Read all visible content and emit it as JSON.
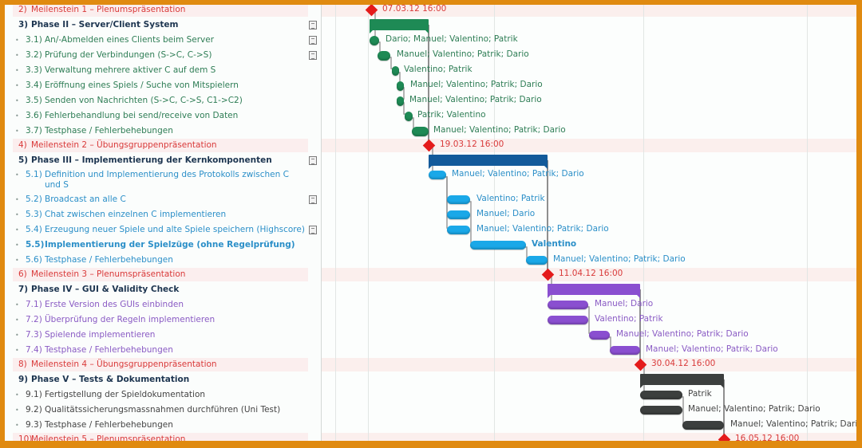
{
  "colors": {
    "phase2": "#1e8a55",
    "phase3": "#135a9a",
    "phase3_task": "#1aa8e8",
    "phase4": "#8a4fd0",
    "phase5": "#3c3f3e",
    "milestone": "#e41b1b",
    "frame": "#e08a10"
  },
  "tasks": [
    {
      "num": "2)",
      "label": "Meilenstein 1 – Plenumspräsentation",
      "kind": "milestone",
      "date": "07.03.12 16:00"
    },
    {
      "num": "3)",
      "label": "Phase II – Server/Client System",
      "kind": "phase",
      "note": true
    },
    {
      "num": "3.1)",
      "label": "An/-Abmelden eines Clients beim Server",
      "kind": "task",
      "note": true,
      "resources": "Dario; Manuel; Valentino; Patrik"
    },
    {
      "num": "3.2)",
      "label": "Prüfung der Verbindungen (S->C, C->S)",
      "kind": "task",
      "note": true,
      "resources": "Manuel; Valentino; Patrik; Dario"
    },
    {
      "num": "3.3)",
      "label": "Verwaltung mehrere aktiver C auf dem S",
      "kind": "task",
      "resources": "Valentino; Patrik"
    },
    {
      "num": "3.4)",
      "label": "Eröffnung eines Spiels / Suche von Mitspielern",
      "kind": "task",
      "resources": "Manuel; Valentino; Patrik; Dario"
    },
    {
      "num": "3.5)",
      "label": "Senden von Nachrichten (S->C, C->S, C1->C2)",
      "kind": "task",
      "resources": "Manuel; Valentino; Patrik; Dario"
    },
    {
      "num": "3.6)",
      "label": "Fehlerbehandlung bei send/receive von Daten",
      "kind": "task",
      "resources": "Patrik; Valentino"
    },
    {
      "num": "3.7)",
      "label": "Testphase / Fehlerbehebungen",
      "kind": "task",
      "resources": "Manuel; Valentino; Patrik; Dario"
    },
    {
      "num": "4)",
      "label": "Meilenstein 2 – Übungsgruppenpräsentation",
      "kind": "milestone",
      "date": "19.03.12 16:00"
    },
    {
      "num": "5)",
      "label": "Phase III – Implementierung der Kernkomponenten",
      "kind": "phase",
      "note": true
    },
    {
      "num": "5.1)",
      "label": "Definition und Implementierung des Protokolls zwischen C und S",
      "kind": "task",
      "resources": "Manuel; Valentino; Patrik; Dario"
    },
    {
      "num": "5.2)",
      "label": "Broadcast an alle C",
      "kind": "task",
      "note": true,
      "resources": "Valentino; Patrik"
    },
    {
      "num": "5.3)",
      "label": "Chat zwischen einzelnen C implementieren",
      "kind": "task",
      "resources": "Manuel; Dario"
    },
    {
      "num": "5.4)",
      "label": "Erzeugung neuer Spiele und alte Spiele speichern (Highscore)",
      "kind": "task",
      "note": true,
      "resources": "Manuel; Valentino; Patrik; Dario"
    },
    {
      "num": "5.5)",
      "label": "Implementierung der Spielzüge (ohne Regelprüfung)",
      "kind": "task",
      "bold": true,
      "resources": "Valentino"
    },
    {
      "num": "5.6)",
      "label": "Testphase / Fehlerbehebungen",
      "kind": "task",
      "resources": "Manuel; Valentino; Patrik; Dario"
    },
    {
      "num": "6)",
      "label": "Meilenstein 3 – Plenumspräsentation",
      "kind": "milestone",
      "date": "11.04.12 16:00"
    },
    {
      "num": "7)",
      "label": "Phase IV – GUI & Validity Check",
      "kind": "phase"
    },
    {
      "num": "7.1)",
      "label": "Erste Version des GUIs einbinden",
      "kind": "task",
      "resources": "Manuel; Dario"
    },
    {
      "num": "7.2)",
      "label": "Überprüfung der Regeln implementieren",
      "kind": "task",
      "resources": "Valentino; Patrik"
    },
    {
      "num": "7.3)",
      "label": "Spielende implementieren",
      "kind": "task",
      "resources": "Manuel; Valentino; Patrik; Dario"
    },
    {
      "num": "7.4)",
      "label": "Testphase / Fehlerbehebungen",
      "kind": "task",
      "resources": "Manuel; Valentino; Patrik; Dario"
    },
    {
      "num": "8)",
      "label": "Meilenstein 4 – Übungsgruppenpräsentation",
      "kind": "milestone",
      "date": "30.04.12 16:00"
    },
    {
      "num": "9)",
      "label": "Phase V – Tests & Dokumentation",
      "kind": "phase"
    },
    {
      "num": "9.1)",
      "label": "Fertigstellung der Spieldokumentation",
      "kind": "task",
      "resources": "Patrik"
    },
    {
      "num": "9.2)",
      "label": "Qualitätssicherungsmassnahmen durchführen (Uni Test)",
      "kind": "task",
      "resources": "Manuel; Valentino; Patrik; Dario"
    },
    {
      "num": "9.3)",
      "label": "Testphase / Fehlerbehebungen",
      "kind": "task",
      "resources": "Manuel; Valentino; Patrik; Dario"
    },
    {
      "num": "10)",
      "label": "Meilenstein 5 – Plenumspräsentation",
      "kind": "milestone",
      "date": "16.05.12 16:00"
    }
  ]
}
